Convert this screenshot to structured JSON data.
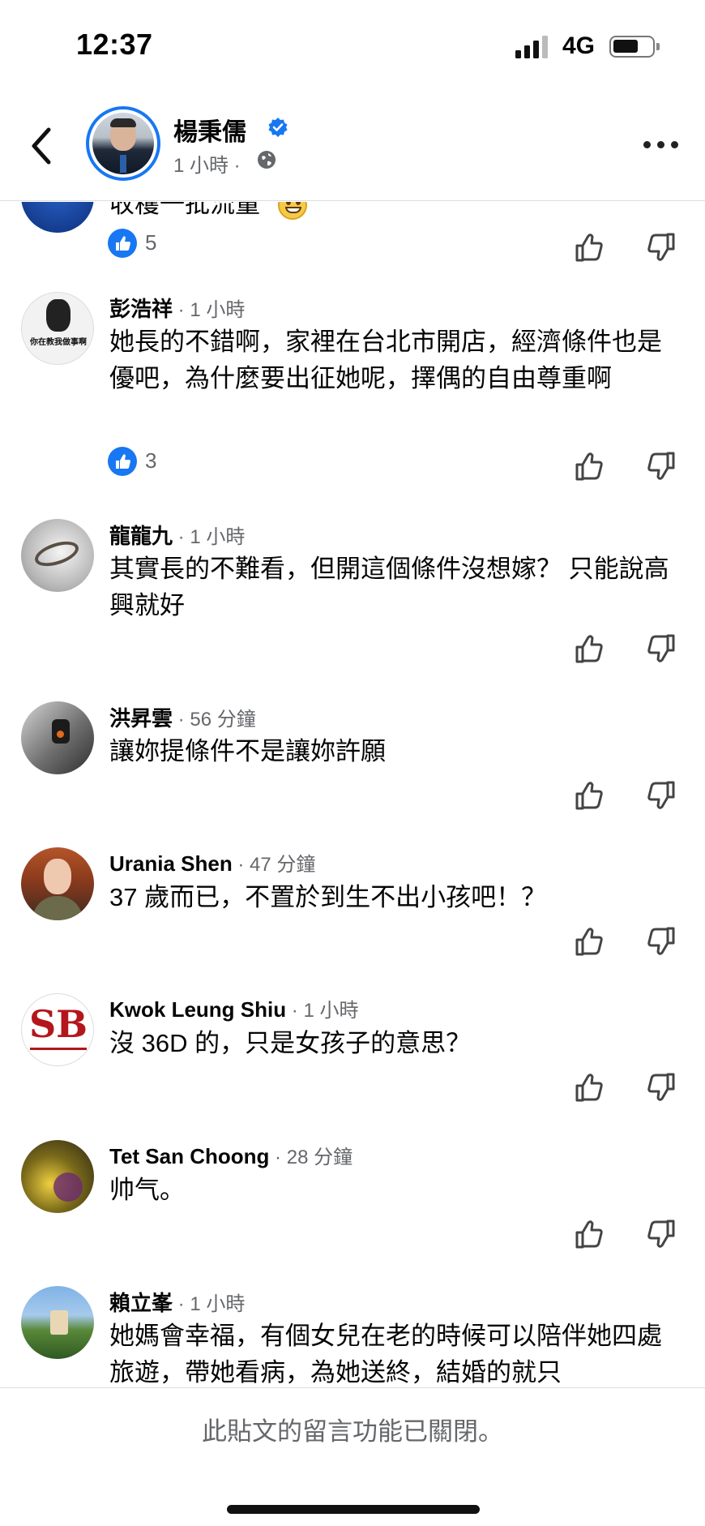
{
  "status": {
    "time": "12:37",
    "network": "4G"
  },
  "header": {
    "name": "楊秉儒",
    "meta": "1 小時 ·"
  },
  "partial_comment": {
    "text": "收穫一批流量",
    "likes": "5"
  },
  "comments": [
    {
      "name": "彭浩祥",
      "time": " · 1 小時",
      "text": "她長的不錯啊，家裡在台北市開店，經濟條件也是優吧，為什麼要出征她呢，擇偶的自由尊重啊",
      "likes": "3",
      "avatar_text": "你在教我做事啊"
    },
    {
      "name": "龍龍九",
      "time": " · 1 小時",
      "text": "其實長的不難看，但開這個條件沒想嫁？ 只能說高興就好"
    },
    {
      "name": "洪昇雲",
      "time": " · 56 分鐘",
      "text": "讓妳提條件不是讓妳許願"
    },
    {
      "name": "Urania Shen",
      "time": " · 47 分鐘",
      "text": "37 歲而已，不置於到生不出小孩吧！？"
    },
    {
      "name": "Kwok Leung Shiu",
      "time": " · 1 小時",
      "text": "沒 36D 的，只是女孩子的意思？",
      "avatar_text": "SB"
    },
    {
      "name": "Tet San Choong",
      "time": " · 28 分鐘",
      "text": "帅气。"
    },
    {
      "name": "賴立峯",
      "time": " · 1 小時",
      "text": "她媽會幸福，有個女兒在老的時候可以陪伴她四處旅遊，帶她看病，為她送終，結婚的就只"
    }
  ],
  "footer": {
    "closed_message": "此貼文的留言功能已關閉。"
  },
  "colors": {
    "accent": "#1877f2",
    "secondary_text": "#65676b"
  }
}
